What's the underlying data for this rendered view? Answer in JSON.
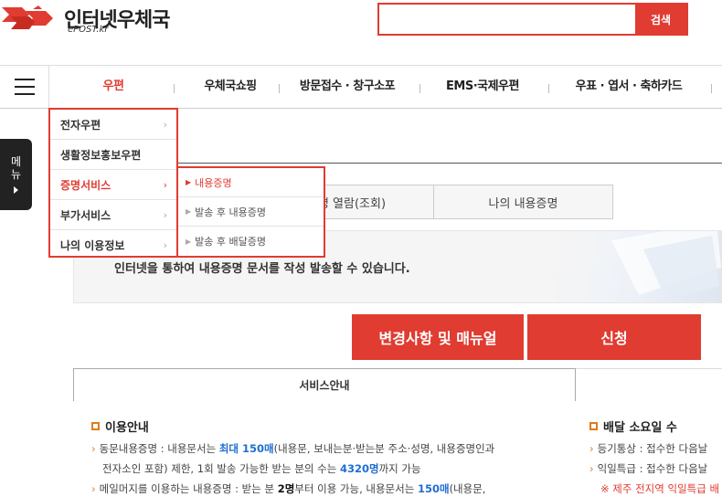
{
  "header": {
    "logo_text": "인터넷우체국",
    "logo_sub": "ePOST.kr",
    "search_placeholder": "",
    "search_button": "검색"
  },
  "gnb": {
    "items": [
      {
        "label": "우편",
        "active": true
      },
      {
        "label": "우체국쇼핑"
      },
      {
        "label": "방문접수 · 창구소포"
      },
      {
        "label": "EMS·국제우편"
      },
      {
        "label": "우표 · 엽서 · 축하카드"
      }
    ]
  },
  "side_tab": {
    "label_1": "메",
    "label_2": "뉴"
  },
  "dropdown": {
    "level1": [
      {
        "label": "전자우편"
      },
      {
        "label": "생활정보홍보우편"
      },
      {
        "label": "증명서비스",
        "active": true
      },
      {
        "label": "부가서비스"
      },
      {
        "label": "나의 이용정보"
      }
    ],
    "level2": [
      {
        "label": "내용증명",
        "active": true
      },
      {
        "label": "발송 후 내용증명"
      },
      {
        "label": "발송 후 배달증명"
      }
    ]
  },
  "sub_tabs": [
    "명 열람(조회)",
    "나의 내용증명"
  ],
  "banner": {
    "text": "인터넷을 통하여 내용증명 문서를 작성 발송할 수 있습니다."
  },
  "buttons": {
    "manual": "변경사항 및 매뉴얼",
    "apply": "신청"
  },
  "service_tab": {
    "label": "서비스안내"
  },
  "usage": {
    "title": "이용안내",
    "line1_a": "동문내용증명 : 내용문서는 ",
    "line1_b": "최대 150매",
    "line1_c": "(내용문, 보내는분·받는분 주소·성명, 내용증명인과",
    "line2_a": "전자소인 포함) 제한, 1회 발송 가능한 받는 분의 수는 ",
    "line2_b": "4320명",
    "line2_c": "까지 가능",
    "line3_a": "메일머지를 이용하는 내용증명 : 받는 분 ",
    "line3_b": "2명",
    "line3_c": "부터 이용 가능, 내용문서는 ",
    "line3_d": "150매",
    "line3_e": "(내용문,"
  },
  "delivery": {
    "title": "배달 소요일 수",
    "line1": "등기통상 : 접수한 다음날",
    "line2": "익일특급 : 접수한 다음날",
    "note": "※ 제주 전지역 익일특급 배"
  },
  "colors": {
    "accent": "#e03c31",
    "highlight_blue": "#1f6fd1",
    "bullet_orange": "#e07a1e"
  }
}
